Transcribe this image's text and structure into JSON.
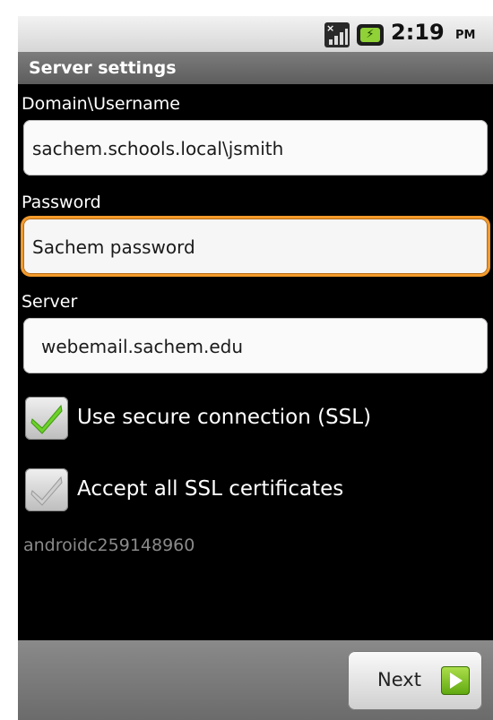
{
  "status_bar": {
    "time": "2:19",
    "ampm": "PM",
    "icons": [
      "signal-icon",
      "battery-icon"
    ],
    "battery_color": "#8fd136"
  },
  "title_bar": {
    "title": "Server settings"
  },
  "form": {
    "domain_username": {
      "label": "Domain\\Username",
      "value": "sachem.schools.local\\jsmith"
    },
    "password": {
      "label": "Password",
      "value": "Sachem password",
      "focused": true
    },
    "server": {
      "label": "Server",
      "value": "webemail.sachem.edu"
    }
  },
  "options": {
    "use_ssl": {
      "label": "Use secure connection (SSL)",
      "checked": true
    },
    "accept_all_certs": {
      "label": "Accept all SSL certificates",
      "checked": true
    }
  },
  "device_id": "androidc259148960",
  "bottom_bar": {
    "next_label": "Next",
    "next_icon": "arrow-right-icon"
  },
  "colors": {
    "focus_orange": "#f39a2b",
    "check_green": "#6dd12a",
    "check_grey": "#bdbdbd"
  }
}
